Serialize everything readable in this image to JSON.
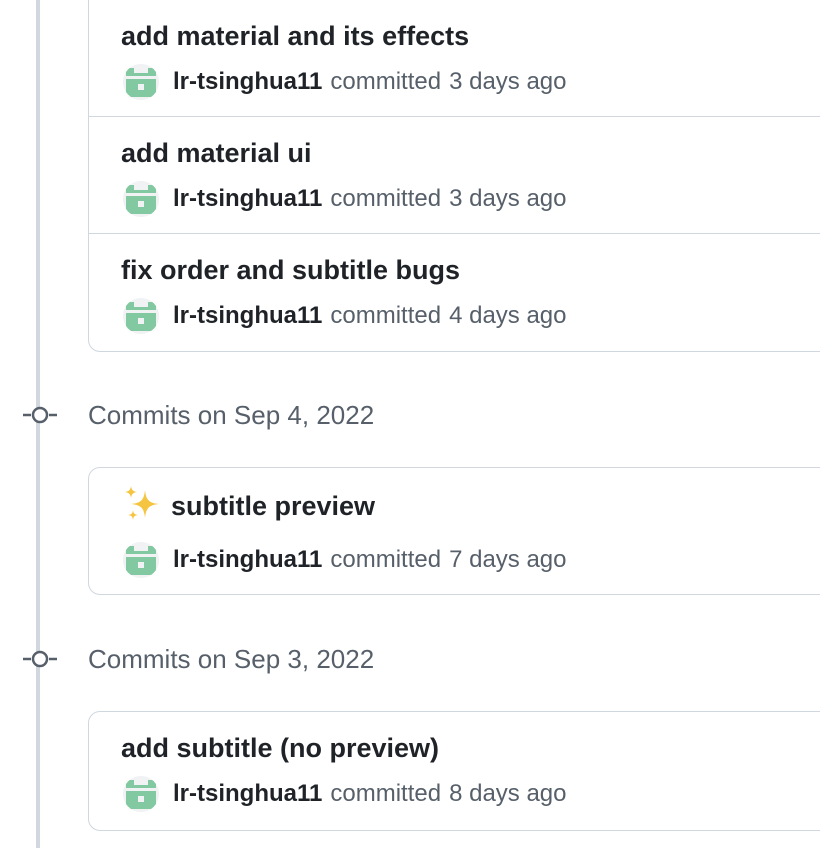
{
  "groups": [
    {
      "header": null,
      "commits": [
        {
          "title": "add material and its effects",
          "author": "lr-tsinghua11",
          "verb": "committed",
          "when": "3 days ago"
        },
        {
          "title": "add material ui",
          "author": "lr-tsinghua11",
          "verb": "committed",
          "when": "3 days ago"
        },
        {
          "title": "fix order and subtitle bugs",
          "author": "lr-tsinghua11",
          "verb": "committed",
          "when": "4 days ago"
        }
      ]
    },
    {
      "header": "Commits on Sep 4, 2022",
      "commits": [
        {
          "emoji": "sparkles",
          "title": "subtitle preview",
          "author": "lr-tsinghua11",
          "verb": "committed",
          "when": "7 days ago"
        }
      ]
    },
    {
      "header": "Commits on Sep 3, 2022",
      "commits": [
        {
          "title": "add subtitle (no preview)",
          "author": "lr-tsinghua11",
          "verb": "committed",
          "when": "8 days ago"
        }
      ]
    }
  ],
  "colors": {
    "avatar_green": "#82c8a0",
    "border": "#d0d7de",
    "muted_text": "#57606a",
    "timeline": "#d0d7de"
  }
}
